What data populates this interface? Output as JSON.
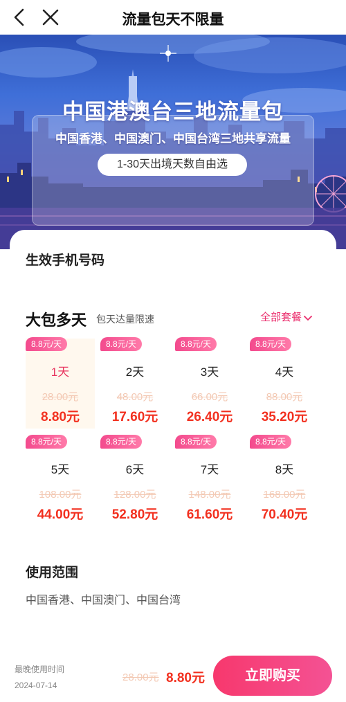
{
  "header": {
    "title": "流量包天不限量",
    "back_icon": "chevron-left-icon",
    "close_icon": "close-icon"
  },
  "banner": {
    "title": "中国港澳台三地流量包",
    "subtitle": "中国香港、中国澳门、中国台湾三地共享流量",
    "pill": "1-30天出境天数自由选"
  },
  "phone": {
    "label": "生效手机号码"
  },
  "packages": {
    "title": "大包多天",
    "subtitle": "包天达量限速",
    "all_label": "全部套餐",
    "items": [
      {
        "badge": "8.8元/天",
        "days": "1天",
        "original": "28.00元",
        "price": "8.80元",
        "selected": true
      },
      {
        "badge": "8.8元/天",
        "days": "2天",
        "original": "48.00元",
        "price": "17.60元",
        "selected": false
      },
      {
        "badge": "8.8元/天",
        "days": "3天",
        "original": "66.00元",
        "price": "26.40元",
        "selected": false
      },
      {
        "badge": "8.8元/天",
        "days": "4天",
        "original": "88.00元",
        "price": "35.20元",
        "selected": false
      },
      {
        "badge": "8.8元/天",
        "days": "5天",
        "original": "108.00元",
        "price": "44.00元",
        "selected": false
      },
      {
        "badge": "8.8元/天",
        "days": "6天",
        "original": "128.00元",
        "price": "52.80元",
        "selected": false
      },
      {
        "badge": "8.8元/天",
        "days": "7天",
        "original": "148.00元",
        "price": "61.60元",
        "selected": false
      },
      {
        "badge": "8.8元/天",
        "days": "8天",
        "original": "168.00元",
        "price": "70.40元",
        "selected": false
      }
    ]
  },
  "usage": {
    "title": "使用范围",
    "text": "中国香港、中国澳门、中国台湾"
  },
  "footer": {
    "deadline_label": "最晚使用时间",
    "deadline_date": "2024-07-14",
    "original_price": "28.00元",
    "price": "8.80元",
    "buy_label": "立即购买"
  },
  "colors": {
    "accent": "#f2301f",
    "brand_pink": "#f7386d",
    "badge_pink": "#f34a8d",
    "selected_bg": "#fff8ee"
  }
}
